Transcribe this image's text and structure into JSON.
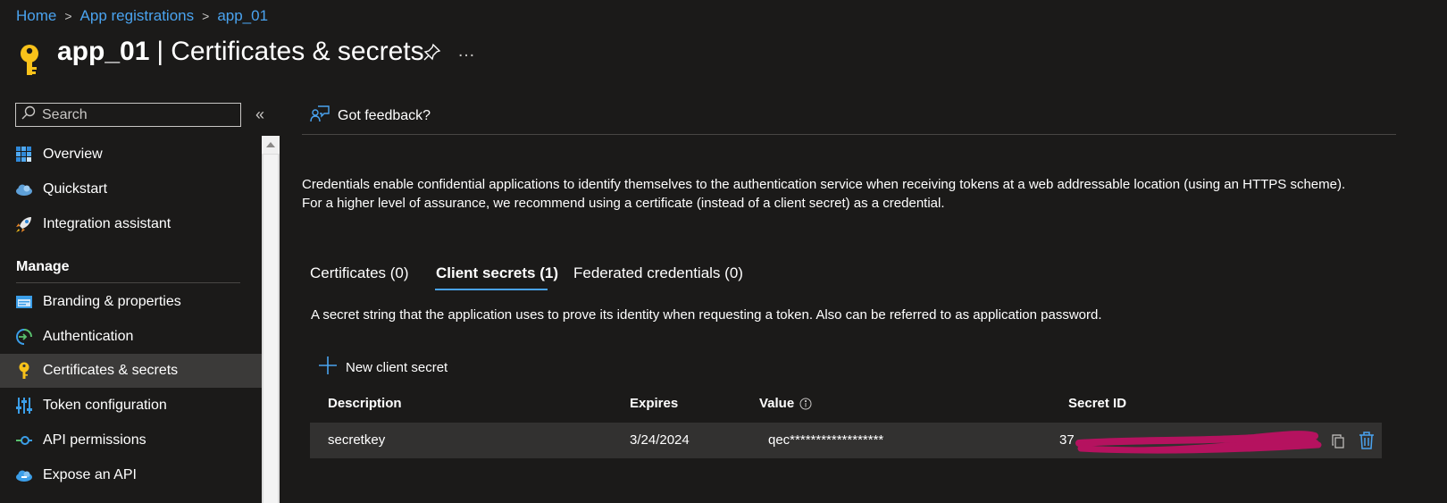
{
  "breadcrumb": {
    "items": [
      "Home",
      "App registrations",
      "app_01"
    ],
    "separator": ">"
  },
  "header": {
    "app_name": "app_01",
    "separator": "|",
    "section": "Certificates & secrets",
    "more_label": "…",
    "icon": "key-icon"
  },
  "sidebar": {
    "search_placeholder": "Search",
    "collapse_label": "«",
    "items": [
      {
        "label": "Overview",
        "icon": "overview-grid-icon"
      },
      {
        "label": "Quickstart",
        "icon": "quickstart-cloud-icon"
      },
      {
        "label": "Integration assistant",
        "icon": "rocket-icon"
      }
    ],
    "manage_header": "Manage",
    "manage_items": [
      {
        "label": "Branding & properties",
        "icon": "branding-icon"
      },
      {
        "label": "Authentication",
        "icon": "authentication-icon"
      },
      {
        "label": "Certificates & secrets",
        "icon": "key-icon",
        "selected": true
      },
      {
        "label": "Token configuration",
        "icon": "token-sliders-icon"
      },
      {
        "label": "API permissions",
        "icon": "api-permissions-icon"
      },
      {
        "label": "Expose an API",
        "icon": "expose-api-cloud-icon"
      }
    ]
  },
  "main": {
    "feedback_label": "Got feedback?",
    "description": "Credentials enable confidential applications to identify themselves to the authentication service when receiving tokens at a web addressable location (using an HTTPS scheme). For a higher level of assurance, we recommend using a certificate (instead of a client secret) as a credential.",
    "tabs": [
      {
        "label": "Certificates (0)",
        "active": false
      },
      {
        "label": "Client secrets (1)",
        "active": true
      },
      {
        "label": "Federated credentials (0)",
        "active": false
      }
    ],
    "secrets_description": "A secret string that the application uses to prove its identity when requesting a token. Also can be referred to as application password.",
    "new_secret_label": "New client secret",
    "table": {
      "columns": [
        "Description",
        "Expires",
        "Value",
        "Secret ID"
      ],
      "rows": [
        {
          "description": "secretkey",
          "expires": "3/24/2024",
          "value": "qec******************",
          "secret_id": "37"
        }
      ]
    }
  },
  "colors": {
    "background": "#1b1a19",
    "accent": "#4aa3ef",
    "selected": "#3b3a39",
    "row": "#323130",
    "redaction": "#b5125f"
  }
}
